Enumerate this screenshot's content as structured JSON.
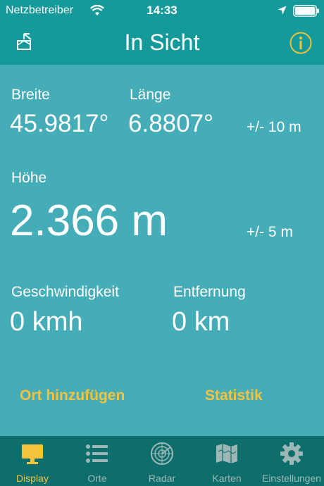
{
  "status_bar": {
    "carrier": "Netzbetreiber",
    "time": "14:33"
  },
  "header": {
    "title": "In Sicht"
  },
  "position": {
    "latitude_label": "Breite",
    "latitude_value": "45.9817°",
    "longitude_label": "Länge",
    "longitude_value": "6.8807°",
    "accuracy": "+/- 10 m"
  },
  "altitude": {
    "label": "Höhe",
    "value": "2.366 m",
    "accuracy": "+/- 5 m"
  },
  "motion": {
    "speed_label": "Geschwindigkeit",
    "speed_value": "0 kmh",
    "distance_label": "Entfernung",
    "distance_value": "0 km"
  },
  "actions": {
    "add_place": "Ort hinzufügen",
    "statistics": "Statistik"
  },
  "tabs": [
    {
      "label": "Display",
      "icon": "monitor-icon",
      "active": true
    },
    {
      "label": "Orte",
      "icon": "list-icon",
      "active": false
    },
    {
      "label": "Radar",
      "icon": "radar-icon",
      "active": false
    },
    {
      "label": "Karten",
      "icon": "map-icon",
      "active": false
    },
    {
      "label": "Einstellungen",
      "icon": "gear-icon",
      "active": false
    }
  ],
  "colors": {
    "header": "#159a9c",
    "background": "#45adb8",
    "accent": "#f5c33b",
    "tab_bar": "#0e6e6c",
    "tab_inactive": "#9cb7b5"
  }
}
